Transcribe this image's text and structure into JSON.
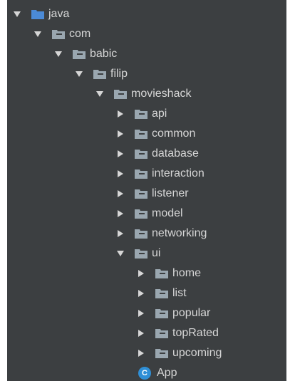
{
  "tree": {
    "items": [
      {
        "label": "java",
        "expanded": true,
        "icon": "folder-icon-blue"
      },
      {
        "label": "com",
        "expanded": true,
        "icon": "folder-icon"
      },
      {
        "label": "babic",
        "expanded": true,
        "icon": "folder-icon"
      },
      {
        "label": "filip",
        "expanded": true,
        "icon": "folder-icon"
      },
      {
        "label": "movieshack",
        "expanded": true,
        "icon": "folder-icon"
      },
      {
        "label": "api",
        "expanded": false,
        "icon": "folder-icon"
      },
      {
        "label": "common",
        "expanded": false,
        "icon": "folder-icon"
      },
      {
        "label": "database",
        "expanded": false,
        "icon": "folder-icon"
      },
      {
        "label": "interaction",
        "expanded": false,
        "icon": "folder-icon"
      },
      {
        "label": "listener",
        "expanded": false,
        "icon": "folder-icon"
      },
      {
        "label": "model",
        "expanded": false,
        "icon": "folder-icon"
      },
      {
        "label": "networking",
        "expanded": false,
        "icon": "folder-icon"
      },
      {
        "label": "ui",
        "expanded": true,
        "icon": "folder-icon"
      },
      {
        "label": "home",
        "expanded": false,
        "icon": "folder-icon"
      },
      {
        "label": "list",
        "expanded": false,
        "icon": "folder-icon"
      },
      {
        "label": "popular",
        "expanded": false,
        "icon": "folder-icon"
      },
      {
        "label": "topRated",
        "expanded": false,
        "icon": "folder-icon"
      },
      {
        "label": "upcoming",
        "expanded": false,
        "icon": "folder-icon"
      },
      {
        "label": "App",
        "expanded": null,
        "icon": "class-icon",
        "icon_text": "C"
      }
    ]
  },
  "colors": {
    "background": "#3c3f41",
    "text": "#d6d6d6",
    "folder": "#9aa7b0",
    "folder_blue": "#4b8ad6",
    "class_icon": "#2f8fd6"
  }
}
